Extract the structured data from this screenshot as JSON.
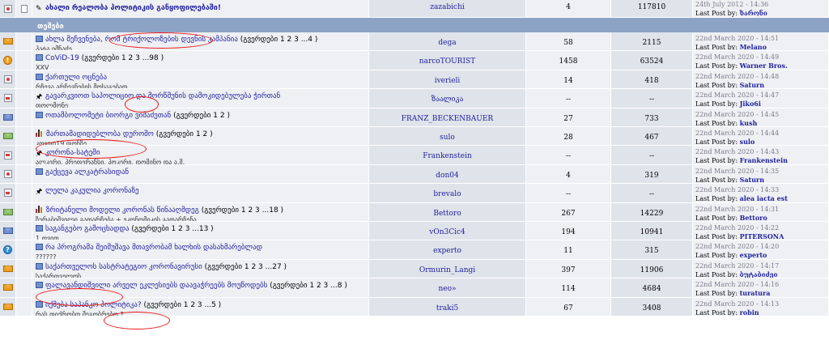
{
  "top_row": {
    "title": "ახალი რეალობა პოლიტიკის განყოფილებაში!",
    "starter": "zazabichi",
    "replies": "4",
    "views": "117810",
    "date": "24th July 2012 - 14:36",
    "by_label": "Last Post by:",
    "by_user": "ხარონი"
  },
  "section_label": "თემები",
  "last_post_label": "Last Post by:",
  "rows": [
    {
      "title": "ახლა მეჩვენება, რომ ტრიქოლოზების დევნის კამპანია",
      "pages": "(გვერდები 1 2 3 ...4 )",
      "sub": "პატა იმნაძე",
      "starter": "dega",
      "replies": "58",
      "views": "2115",
      "date": "22nd March 2020 - 14:51",
      "user": "Melano"
    },
    {
      "title": "CoViD-19",
      "pages": "(გვერდები 1 2 3 ...98 )",
      "sub": "XXV",
      "starter": "narcoTOURIST",
      "replies": "1458",
      "views": "63524",
      "date": "22nd March 2020 - 14:49",
      "user": "Warner Bros."
    },
    {
      "title": "ქართული ოცნება",
      "pages": "",
      "sub": "რჩევა არჩევნების მოსაგებად",
      "starter": "iverieli",
      "replies": "14",
      "views": "418",
      "date": "22nd March 2020 - 14:48",
      "user": "Saturn"
    },
    {
      "title": "გავარკვიოთ საპოლიციო და მორწმუნის დამოკიდებულება ჭირთან",
      "pages": "",
      "sub": "ფოლმონე",
      "starter": "ზაალიკა",
      "replies": "--",
      "views": "--",
      "date": "22nd March 2020 - 14:47",
      "user": "Jiko6i"
    },
    {
      "title": "ოთამბოლომეტი ბიორგი ვიმაძეთან",
      "pages": "(გვერდები 1 2 )",
      "sub": "",
      "starter": "FRANZ_BECKENBAUER",
      "replies": "27",
      "views": "733",
      "date": "22nd March 2020 - 14:45",
      "user": "kush"
    },
    {
      "title": "მართამადიდებლობა დუროშო",
      "pages": "(გვერდები 1 2 )",
      "sub": "კოვიდ19 ფონზე",
      "starter": "sulo",
      "replies": "28",
      "views": "467",
      "date": "22nd March 2020 - 14:44",
      "user": "sulo"
    },
    {
      "title": "კორონა-სატემი",
      "pages": "",
      "sub": "ალკერი, პრეფერანსი, პოკერი, დომინო და ა.შ.",
      "starter": "Frankenstein",
      "replies": "--",
      "views": "--",
      "date": "22nd March 2020 - 14:43",
      "user": "Frankenstein"
    },
    {
      "title": "გაქცევა ალკატრასიდან",
      "pages": "",
      "sub": "",
      "starter": "don04",
      "replies": "4",
      "views": "319",
      "date": "22nd March 2020 - 14:35",
      "user": "Saturn"
    },
    {
      "title": "ლელა კაკულია კორონაზე",
      "pages": "",
      "sub": "",
      "starter": "brevalo",
      "replies": "--",
      "views": "--",
      "date": "22nd March 2020 - 14:33",
      "user": "alea iacta est"
    },
    {
      "title": "ზრიტანელი მოდელი კორონას წინააღმდეგ",
      "pages": "(გვერდები 1 2 3 ...18 )",
      "sub": "ზურაბიშვილი გადარჩება + ეკონომიკის გადარჩენა",
      "starter": "Bettoro",
      "replies": "267",
      "views": "14229",
      "date": "22nd March 2020 - 14:31",
      "user": "Bettoro"
    },
    {
      "title": "საგანგებო გამოცხადდა",
      "pages": "(გვერდები 1 2 3 ...13 )",
      "sub": "1 თვით",
      "starter": "vOn3Cic4",
      "replies": "194",
      "views": "10941",
      "date": "22nd March 2020 - 14:22",
      "user": "PITERSONA"
    },
    {
      "title": "რა პროგრამა შეიმუშავა მთავრობამ ხალხის დასახმარებლად",
      "pages": "",
      "sub": "??????",
      "starter": "experto",
      "replies": "11",
      "views": "315",
      "date": "22nd March 2020 - 14:20",
      "user": "experto"
    },
    {
      "title": "საქართველოს სასტრატეგიო კორონავირუსი",
      "pages": "(გვერდები 1 2 3 ...27 )",
      "sub": "საქართველოს",
      "starter": "Ormurin_Langi",
      "replies": "397",
      "views": "11906",
      "date": "22nd March 2020 - 14:17",
      "user": "ბუტაბიძეი"
    },
    {
      "title": "ფალავანდიშვილი არველ ეკლესიებს დაავაჭრეებს მოუწოდებს",
      "pages": "(გვერდები 1 2 3 ...8 )",
      "sub": "",
      "starter": "neo»",
      "replies": "114",
      "views": "4684",
      "date": "22nd March 2020 - 14:16",
      "user": "turatura"
    },
    {
      "title": "იქმება საპანკო პოლიტიკა?",
      "pages": "(გვერდები 1 2 3 ...5 )",
      "sub": "რას ფიქრობთ მეგობრებო ?",
      "starter": "traki5",
      "replies": "67",
      "views": "3408",
      "date": "22nd March 2020 - 14:13",
      "user": "robin"
    }
  ]
}
